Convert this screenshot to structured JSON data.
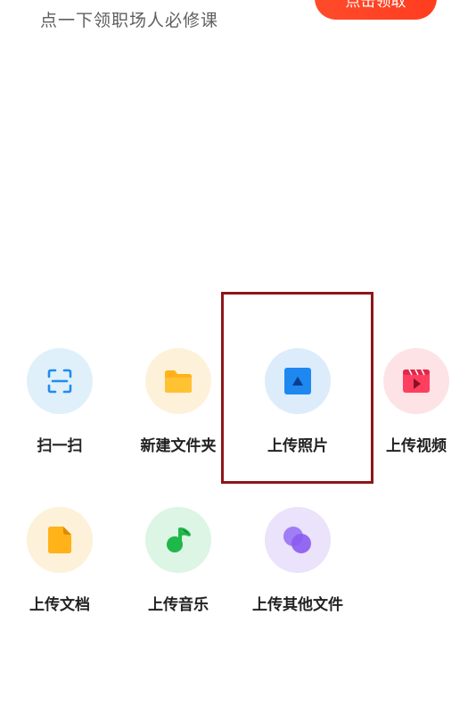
{
  "banner": {
    "promo_text": "点一下领职场人必修课",
    "claim_label": "点击领取"
  },
  "actions": [
    {
      "label": "扫一扫",
      "icon": "scan-icon",
      "bg": "#dff0fb",
      "color": "#1f8cf0"
    },
    {
      "label": "新建文件夹",
      "icon": "folder-icon",
      "bg": "#fdf1d9",
      "color": "#ffb319"
    },
    {
      "label": "上传照片",
      "icon": "photo-icon",
      "bg": "#dcecfb",
      "color": "#1e88f0"
    },
    {
      "label": "上传视频",
      "icon": "video-icon",
      "bg": "#fde3e6",
      "color": "#ff3f5f"
    },
    {
      "label": "上传文档",
      "icon": "document-icon",
      "bg": "#fdf1d9",
      "color": "#ffb319"
    },
    {
      "label": "上传音乐",
      "icon": "music-icon",
      "bg": "#dcf5e4",
      "color": "#1fb84a"
    },
    {
      "label": "上传其他文件",
      "icon": "other-files-icon",
      "bg": "#ebe2fb",
      "color": "#8a5cf0"
    }
  ],
  "highlight": {
    "target": "上传照片",
    "color": "#8e1518"
  }
}
